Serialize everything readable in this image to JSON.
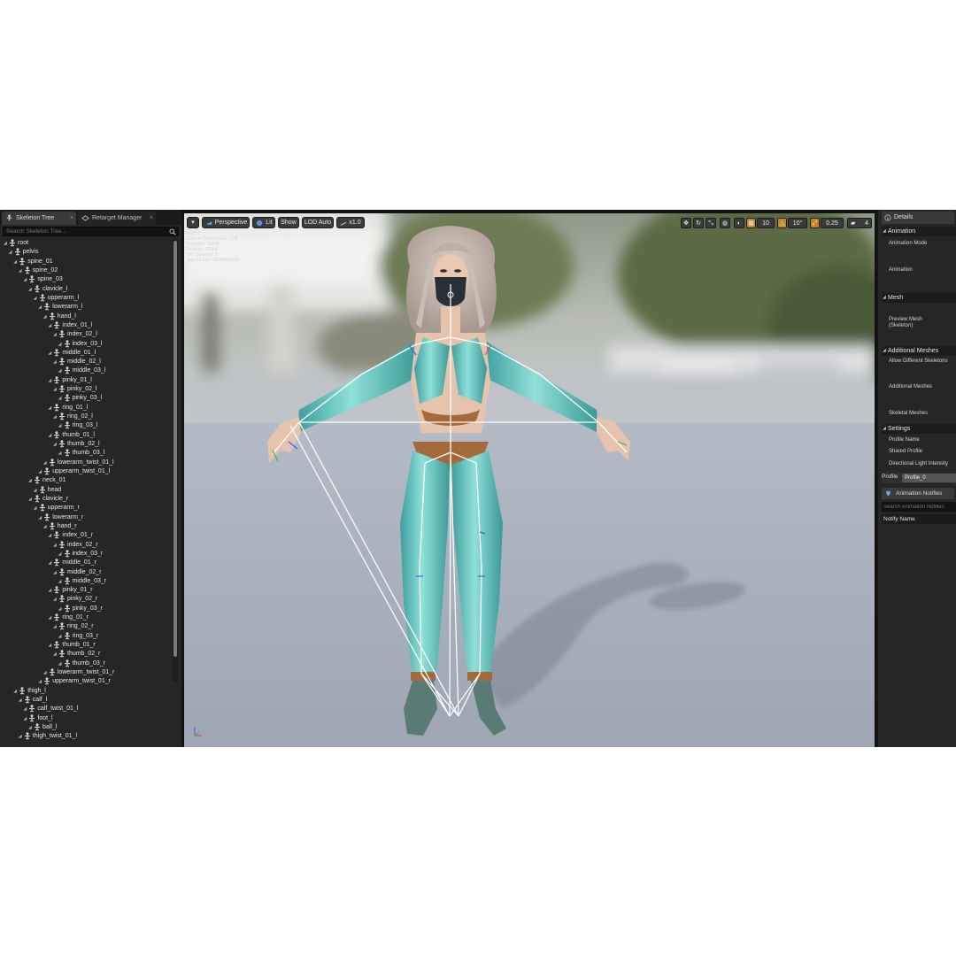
{
  "left_panel": {
    "tabs": [
      {
        "label": "Skeleton Tree"
      },
      {
        "label": "Retarget Manager"
      }
    ],
    "search_placeholder": "Search Skeleton Tree...",
    "bones": [
      {
        "name": "root",
        "depth": 0
      },
      {
        "name": "pelvis",
        "depth": 1
      },
      {
        "name": "spine_01",
        "depth": 2
      },
      {
        "name": "spine_02",
        "depth": 3
      },
      {
        "name": "spine_03",
        "depth": 4
      },
      {
        "name": "clavicle_l",
        "depth": 5
      },
      {
        "name": "upperarm_l",
        "depth": 6
      },
      {
        "name": "lowerarm_l",
        "depth": 7
      },
      {
        "name": "hand_l",
        "depth": 8
      },
      {
        "name": "index_01_l",
        "depth": 9
      },
      {
        "name": "index_02_l",
        "depth": 10
      },
      {
        "name": "index_03_l",
        "depth": 11
      },
      {
        "name": "middle_01_l",
        "depth": 9
      },
      {
        "name": "middle_02_l",
        "depth": 10
      },
      {
        "name": "middle_03_l",
        "depth": 11
      },
      {
        "name": "pinky_01_l",
        "depth": 9
      },
      {
        "name": "pinky_02_l",
        "depth": 10
      },
      {
        "name": "pinky_03_l",
        "depth": 11
      },
      {
        "name": "ring_01_l",
        "depth": 9
      },
      {
        "name": "ring_02_l",
        "depth": 10
      },
      {
        "name": "ring_03_l",
        "depth": 11
      },
      {
        "name": "thumb_01_l",
        "depth": 9
      },
      {
        "name": "thumb_02_l",
        "depth": 10
      },
      {
        "name": "thumb_03_l",
        "depth": 11
      },
      {
        "name": "lowerarm_twist_01_l",
        "depth": 8
      },
      {
        "name": "upperarm_twist_01_l",
        "depth": 7
      },
      {
        "name": "neck_01",
        "depth": 5
      },
      {
        "name": "head",
        "depth": 6
      },
      {
        "name": "clavicle_r",
        "depth": 5
      },
      {
        "name": "upperarm_r",
        "depth": 6
      },
      {
        "name": "lowerarm_r",
        "depth": 7
      },
      {
        "name": "hand_r",
        "depth": 8
      },
      {
        "name": "index_01_r",
        "depth": 9
      },
      {
        "name": "index_02_r",
        "depth": 10
      },
      {
        "name": "index_03_r",
        "depth": 11
      },
      {
        "name": "middle_01_r",
        "depth": 9
      },
      {
        "name": "middle_02_r",
        "depth": 10
      },
      {
        "name": "middle_03_r",
        "depth": 11
      },
      {
        "name": "pinky_01_r",
        "depth": 9
      },
      {
        "name": "pinky_02_r",
        "depth": 10
      },
      {
        "name": "pinky_03_r",
        "depth": 11
      },
      {
        "name": "ring_01_r",
        "depth": 9
      },
      {
        "name": "ring_02_r",
        "depth": 10
      },
      {
        "name": "ring_03_r",
        "depth": 11
      },
      {
        "name": "thumb_01_r",
        "depth": 9
      },
      {
        "name": "thumb_02_r",
        "depth": 10
      },
      {
        "name": "thumb_03_r",
        "depth": 11
      },
      {
        "name": "lowerarm_twist_01_r",
        "depth": 8
      },
      {
        "name": "upperarm_twist_01_r",
        "depth": 7
      },
      {
        "name": "thigh_l",
        "depth": 2
      },
      {
        "name": "calf_l",
        "depth": 3
      },
      {
        "name": "calf_twist_01_l",
        "depth": 4
      },
      {
        "name": "foot_l",
        "depth": 4
      },
      {
        "name": "ball_l",
        "depth": 5
      },
      {
        "name": "thigh_twist_01_l",
        "depth": 3
      }
    ]
  },
  "viewport": {
    "toolbar": {
      "perspective": "Perspective",
      "lit": "Lit",
      "show": "Show",
      "lod": "LOD Auto",
      "speed": "x1.0"
    },
    "right_toolbar": {
      "grid_snap": "10",
      "rotation_snap": "10°",
      "scale_snap": "0.25",
      "camera_speed": "4"
    },
    "stats": [
      "LOD: 0",
      "Current Screen Size: 1.08",
      "Triangles: 60646",
      "Vertices: 55664",
      "UV Channels: 1",
      "Approx Size: 354x556x209"
    ],
    "overlay_text": "Previewing Reference Pose"
  },
  "right_panel": {
    "tab": "Details",
    "categories": {
      "animation": "Animation",
      "mesh": "Mesh",
      "additional_meshes": "Additional Meshes",
      "settings": "Settings"
    },
    "props": {
      "animation_mode": "Animation Mode",
      "animation": "Animation",
      "preview_mesh": "Preview Mesh\n(Skeleton)",
      "allow_different": "Allow Different Skeletons",
      "additional_meshes": "Additional Meshes",
      "skeletal_meshes": "Skeletal Meshes",
      "profile_name": "Profile Name",
      "shared_profile": "Shared Profile",
      "directional_light": "Directional Light Intensity"
    },
    "profile_label": "Profile",
    "profile_value": "Profile_0",
    "notifies_tab": "Animation Notifies",
    "notifies_search_placeholder": "Search Animation Notifies",
    "notify_column": "Notify Name"
  },
  "colors": {
    "panel_bg": "#262626",
    "accent_orange": "#c5841f",
    "floor": "#a9b0bd",
    "outfit_teal": "#6ecfc8",
    "skin": "#e6c3ad",
    "gold_trim": "#a46a3c"
  }
}
